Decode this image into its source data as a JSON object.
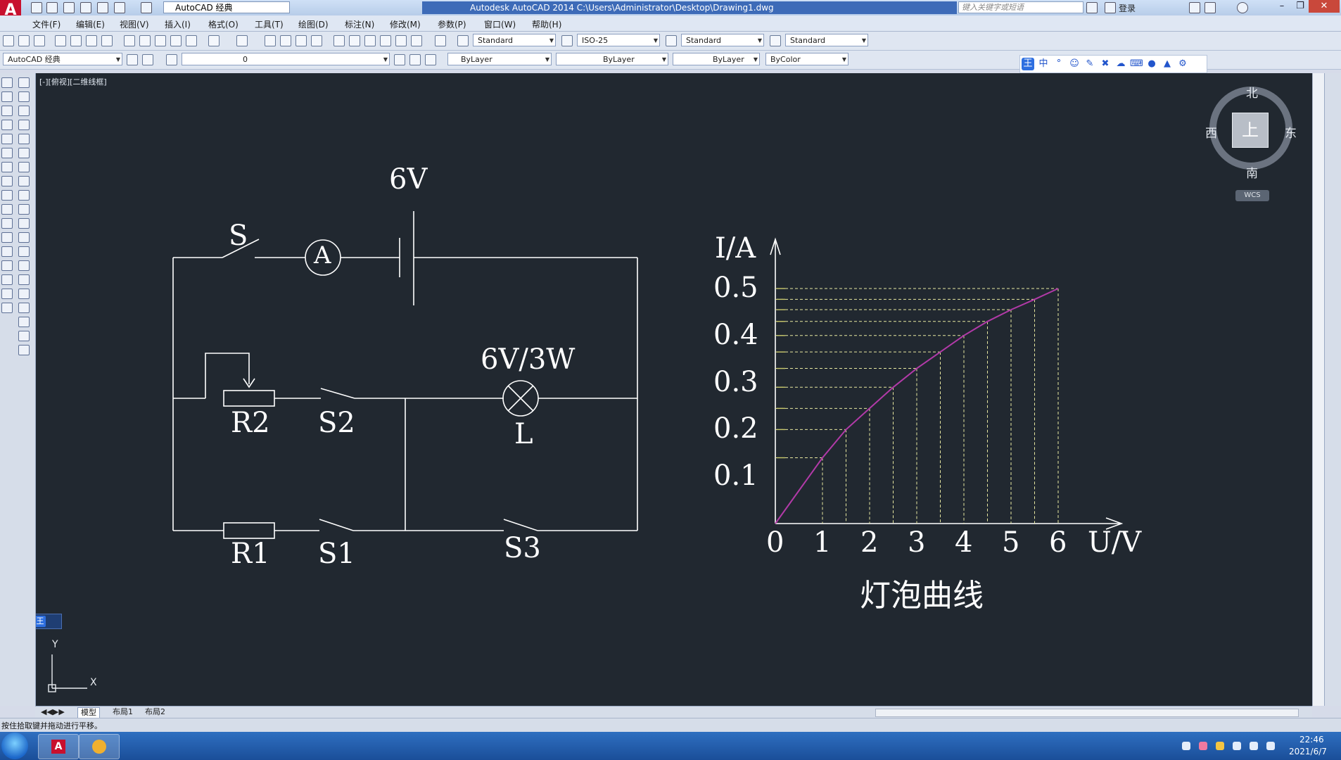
{
  "window": {
    "title": "Autodesk AutoCAD 2014    C:\\Users\\Administrator\\Desktop\\Drawing1.dwg",
    "workspace": "AutoCAD 经典",
    "search_placeholder": "键入关键字或短语",
    "login_label": "登录"
  },
  "menu": [
    "文件(F)",
    "编辑(E)",
    "视图(V)",
    "插入(I)",
    "格式(O)",
    "工具(T)",
    "绘图(D)",
    "标注(N)",
    "修改(M)",
    "参数(P)",
    "窗口(W)",
    "帮助(H)"
  ],
  "toolbar": {
    "text_style": "Standard",
    "dim_style": "ISO-25",
    "table_style": "Standard",
    "multileader_style": "Standard",
    "workspace_combo": "AutoCAD 经典",
    "layer_value": "0",
    "color_value": "ByLayer",
    "linetype_value": "ByLayer",
    "lineweight_value": "ByLayer",
    "plotstyle_value": "ByColor"
  },
  "ime": {
    "logo": "王",
    "mode": "中"
  },
  "viewport_label": "[-][俯视][二维线框]",
  "viewcube": {
    "top": "上",
    "north": "北",
    "south": "南",
    "east": "东",
    "west": "西",
    "wcs": "WCS"
  },
  "circuit": {
    "voltage_label": "6V",
    "switch_s": "S",
    "ammeter": "A",
    "lamp_rating": "6V/3W",
    "lamp_label": "L",
    "r2": "R2",
    "s2": "S2",
    "r1": "R1",
    "s1": "S1",
    "s3": "S3"
  },
  "chart_data": {
    "type": "line",
    "xlabel": "U/V",
    "ylabel": "I/A",
    "caption": "灯泡曲线",
    "x_ticks": [
      "0",
      "1",
      "2",
      "3",
      "4",
      "5",
      "6"
    ],
    "y_ticks": [
      "0.1",
      "0.2",
      "0.3",
      "0.4",
      "0.5"
    ],
    "xlim": [
      0,
      6
    ],
    "ylim": [
      0,
      0.5
    ],
    "series": [
      {
        "color": "#b23aa8",
        "x": [
          0,
          1,
          1.5,
          2,
          2.5,
          3,
          3.5,
          4,
          4.5,
          5,
          5.5,
          6
        ],
        "y": [
          0,
          0.14,
          0.2,
          0.245,
          0.29,
          0.33,
          0.365,
          0.4,
          0.43,
          0.455,
          0.477,
          0.5
        ]
      }
    ]
  },
  "layout_tabs": [
    "模型",
    "布局1",
    "布局2"
  ],
  "status_text": "按住拾取键并拖动进行平移。",
  "ucs": {
    "x": "X",
    "y": "Y"
  },
  "clock": {
    "time": "22:46",
    "date": "2021/6/7"
  }
}
